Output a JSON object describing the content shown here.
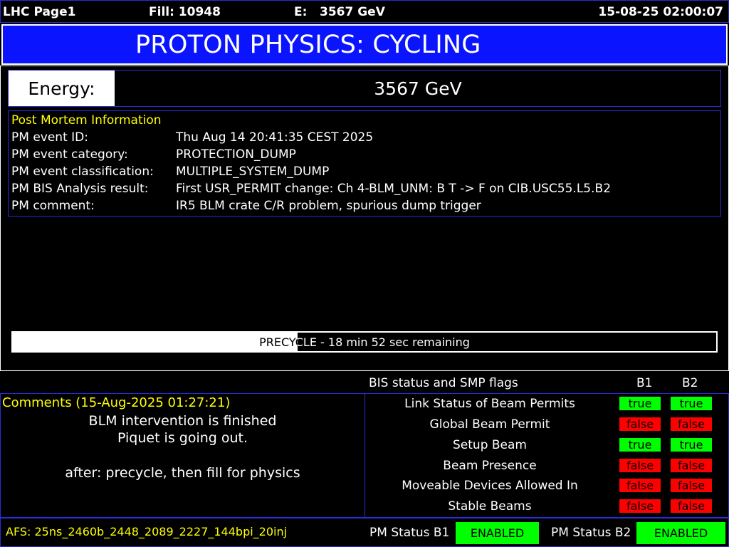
{
  "header": {
    "page": "LHC Page1",
    "fill": "Fill: 10948",
    "energy_label": "E:",
    "energy_value": "3567 GeV",
    "datetime": "15-08-25 02:00:07"
  },
  "banner": {
    "title": "PROTON PHYSICS: CYCLING"
  },
  "energy": {
    "label": "Energy:",
    "value": "3567 GeV"
  },
  "post_mortem": {
    "title": "Post Mortem Information",
    "rows": [
      {
        "key": "PM event ID:",
        "value": "Thu Aug 14 20:41:35 CEST 2025"
      },
      {
        "key": "PM event category:",
        "value": "PROTECTION_DUMP"
      },
      {
        "key": "PM event classification:",
        "value": "MULTIPLE_SYSTEM_DUMP"
      },
      {
        "key": "PM BIS Analysis result:",
        "value": "First USR_PERMIT change: Ch 4-BLM_UNM: B T -> F on CIB.USC55.L5.B2"
      },
      {
        "key": "PM comment:",
        "value": "IR5 BLM crate C/R problem, spurious dump trigger"
      }
    ]
  },
  "progress": {
    "text": "PRECYCLE - 18 min 52 sec remaining",
    "fraction": 0.405
  },
  "bis": {
    "header": "BIS status and SMP flags",
    "b1": "B1",
    "b2": "B2",
    "rows": [
      {
        "label": "Link Status of Beam Permits",
        "b1": "true",
        "b2": "true"
      },
      {
        "label": "Global Beam Permit",
        "b1": "false",
        "b2": "false"
      },
      {
        "label": "Setup Beam",
        "b1": "true",
        "b2": "true"
      },
      {
        "label": "Beam Presence",
        "b1": "false",
        "b2": "false"
      },
      {
        "label": "Moveable Devices Allowed In",
        "b1": "false",
        "b2": "false"
      },
      {
        "label": "Stable Beams",
        "b1": "false",
        "b2": "false"
      }
    ]
  },
  "comments": {
    "title": "Comments (15-Aug-2025 01:27:21)",
    "lines": [
      "BLM intervention is finished",
      "Piquet is going out.",
      "",
      "after: precycle, then fill for physics"
    ]
  },
  "footer": {
    "afs": "AFS: 25ns_2460b_2448_2089_2227_144bpi_20inj",
    "pm_b1_label": "PM Status B1",
    "pm_b1_value": "ENABLED",
    "pm_b2_label": "PM Status B2",
    "pm_b2_value": "ENABLED"
  },
  "colors": {
    "banner_bg": "#0a14ff",
    "true_bg": "#00ff00",
    "false_bg": "#ff0000",
    "accent_yellow": "#ffff00",
    "border_blue": "#2b2bd8"
  }
}
